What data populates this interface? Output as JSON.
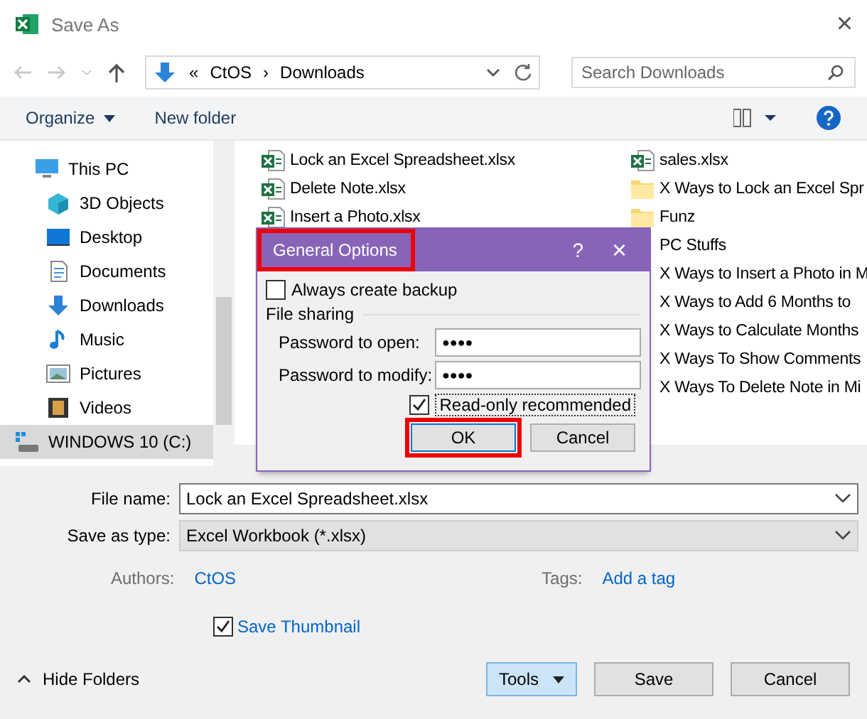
{
  "window": {
    "title": "Save As",
    "close": "×"
  },
  "address": {
    "path": [
      {
        "label": "«"
      },
      {
        "label": "CtOS"
      },
      {
        "label": "›"
      },
      {
        "label": "Downloads"
      }
    ],
    "search_placeholder": "Search Downloads"
  },
  "toolbar": {
    "organize": "Organize",
    "new_folder": "New folder"
  },
  "sidebar": {
    "items": [
      {
        "label": "This PC",
        "kind": "pc",
        "selected": false
      },
      {
        "label": "3D Objects",
        "kind": "cube",
        "selected": false
      },
      {
        "label": "Desktop",
        "kind": "desktop",
        "selected": false
      },
      {
        "label": "Documents",
        "kind": "doc",
        "selected": false
      },
      {
        "label": "Downloads",
        "kind": "download",
        "selected": false
      },
      {
        "label": "Music",
        "kind": "music",
        "selected": false
      },
      {
        "label": "Pictures",
        "kind": "pictures",
        "selected": false
      },
      {
        "label": "Videos",
        "kind": "video",
        "selected": false
      },
      {
        "label": "WINDOWS 10 (C:)",
        "kind": "drive",
        "selected": true
      }
    ]
  },
  "files": {
    "columns": [
      [
        {
          "name": "Lock an Excel Spreadsheet.xlsx",
          "kind": "excel"
        },
        {
          "name": "Delete Note.xlsx",
          "kind": "excel"
        },
        {
          "name": "Insert a Photo.xlsx",
          "kind": "excel"
        }
      ],
      [
        {
          "name": "sales.xlsx",
          "kind": "excel"
        },
        {
          "name": "X Ways to Lock an Excel Spr",
          "kind": "folder"
        },
        {
          "name": "Funz",
          "kind": "folder"
        },
        {
          "name": "PC Stuffs",
          "kind": "hidden"
        },
        {
          "name": "X Ways to Insert a Photo in M",
          "kind": "hidden"
        },
        {
          "name": "X Ways to Add 6 Months to",
          "kind": "hidden"
        },
        {
          "name": "X Ways to Calculate Months",
          "kind": "hidden"
        },
        {
          "name": "X Ways To Show Comments",
          "kind": "hidden"
        },
        {
          "name": "X Ways To Delete Note in Mi",
          "kind": "hidden"
        }
      ]
    ]
  },
  "dialog": {
    "title": "General Options",
    "title_highlighted": true,
    "help": "?",
    "close": "×",
    "backup": {
      "label": "Always create backup",
      "checked": false
    },
    "section": "File sharing",
    "fields": [
      {
        "label": "Password to open:",
        "value": "●●●●"
      },
      {
        "label": "Password to modify:",
        "value": "●●●●"
      }
    ],
    "readonly": {
      "label": "Read-only recommended",
      "checked": true
    },
    "ok": {
      "label": "OK",
      "highlighted": true
    },
    "cancel": "Cancel"
  },
  "form": {
    "file_name_label": "File name:",
    "file_name": "Lock an Excel Spreadsheet.xlsx",
    "type_label": "Save as type:",
    "type": "Excel Workbook (*.xlsx)",
    "authors_label": "Authors:",
    "authors": "CtOS",
    "tags_label": "Tags:",
    "tags": "Add a tag",
    "thumbnail": {
      "label": "Save Thumbnail",
      "checked": true
    }
  },
  "footer": {
    "hide_folders": "Hide Folders",
    "tools": "Tools",
    "save": "Save",
    "cancel": "Cancel"
  }
}
